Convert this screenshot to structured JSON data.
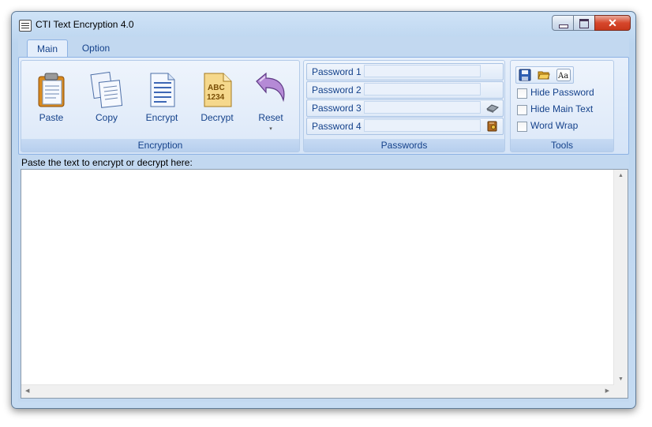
{
  "window": {
    "title": "CTI Text Encryption 4.0",
    "close_glyph": "✕"
  },
  "tabs": [
    {
      "label": "Main"
    },
    {
      "label": "Option"
    }
  ],
  "encryption": {
    "group_label": "Encryption",
    "buttons": [
      {
        "label": "Paste",
        "icon": "clipboard-icon"
      },
      {
        "label": "Copy",
        "icon": "copy-pages-icon"
      },
      {
        "label": "Encrypt",
        "icon": "document-lines-icon"
      },
      {
        "label": "Decrypt",
        "icon": "abc-1234-document-icon",
        "icon_text_1": "ABC",
        "icon_text_2": "1234"
      },
      {
        "label": "Reset",
        "icon": "undo-arrow-icon",
        "dropdown": "▾"
      }
    ]
  },
  "passwords": {
    "group_label": "Passwords",
    "rows": [
      {
        "label": "Password 1",
        "value": ""
      },
      {
        "label": "Password 2",
        "value": ""
      },
      {
        "label": "Password 3",
        "value": "",
        "icon": "eraser-icon"
      },
      {
        "label": "Password 4",
        "value": "",
        "icon": "key-book-icon"
      }
    ]
  },
  "tools": {
    "group_label": "Tools",
    "icons": [
      "save-disk-icon",
      "open-folder-icon",
      "font-aa-icon"
    ],
    "font_icon_text": "Aa",
    "checkboxes": [
      {
        "label": "Hide Password",
        "checked": false
      },
      {
        "label": "Hide Main Text",
        "checked": false
      },
      {
        "label": "Word Wrap",
        "checked": false
      }
    ]
  },
  "editor": {
    "hint": "Paste the text to encrypt or decrypt here:",
    "value": "",
    "scroll_up": "▲",
    "scroll_down": "▼",
    "scroll_left": "◀",
    "scroll_right": "▶"
  }
}
